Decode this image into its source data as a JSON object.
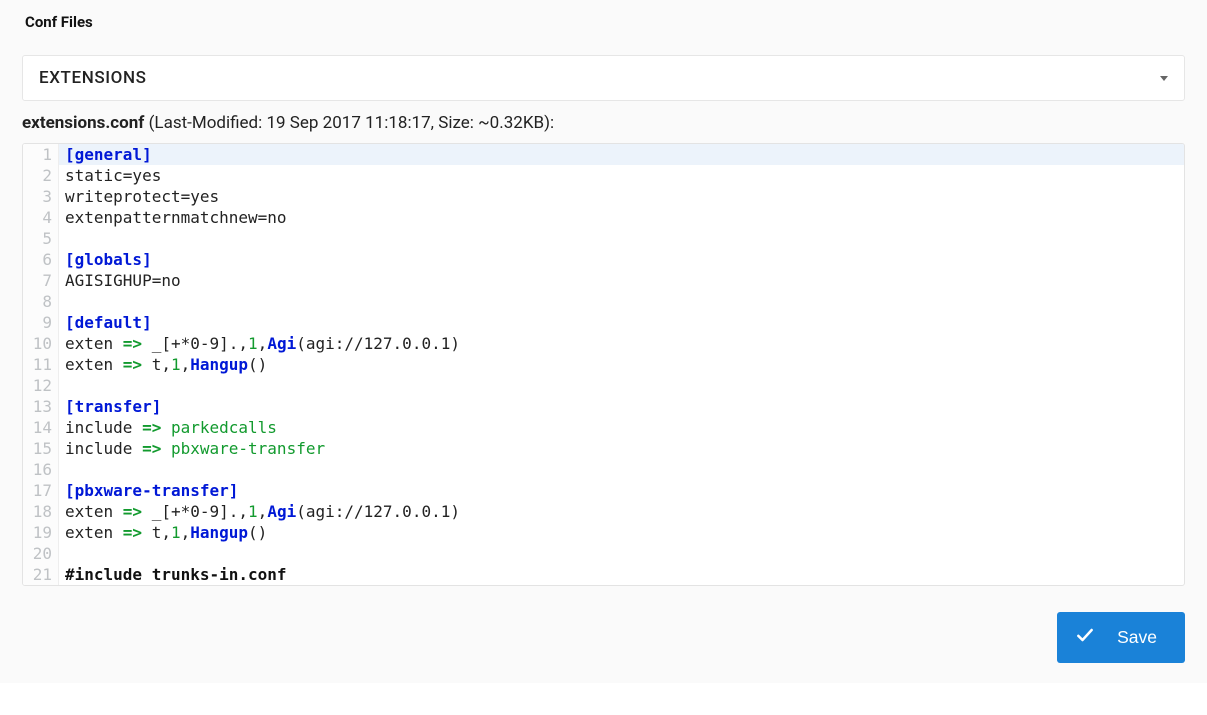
{
  "tab": {
    "label": "Conf Files"
  },
  "selector": {
    "value": "EXTENSIONS"
  },
  "fileinfo": {
    "name": "extensions.conf",
    "meta": " (Last-Modified: 19 Sep 2017 11:18:17, Size: ~0.32KB):"
  },
  "code": {
    "lines": [
      {
        "n": "1",
        "active": true,
        "tokens": [
          {
            "cls": "tok-section",
            "t": "[general]"
          }
        ]
      },
      {
        "n": "2",
        "tokens": [
          {
            "cls": "tok-key",
            "t": "static=yes"
          }
        ]
      },
      {
        "n": "3",
        "tokens": [
          {
            "cls": "tok-key",
            "t": "writeprotect=yes"
          }
        ]
      },
      {
        "n": "4",
        "tokens": [
          {
            "cls": "tok-key",
            "t": "extenpatternmatchnew=no"
          }
        ]
      },
      {
        "n": "5",
        "tokens": [
          {
            "cls": "tok-key",
            "t": ""
          }
        ]
      },
      {
        "n": "6",
        "tokens": [
          {
            "cls": "tok-section",
            "t": "[globals]"
          }
        ]
      },
      {
        "n": "7",
        "tokens": [
          {
            "cls": "tok-key",
            "t": "AGISIGHUP=no"
          }
        ]
      },
      {
        "n": "8",
        "tokens": [
          {
            "cls": "tok-key",
            "t": ""
          }
        ]
      },
      {
        "n": "9",
        "tokens": [
          {
            "cls": "tok-section",
            "t": "[default]"
          }
        ]
      },
      {
        "n": "10",
        "tokens": [
          {
            "cls": "tok-key",
            "t": "exten "
          },
          {
            "cls": "tok-op",
            "t": "=>"
          },
          {
            "cls": "tok-key",
            "t": " _[+*0-9].,"
          },
          {
            "cls": "tok-num",
            "t": "1"
          },
          {
            "cls": "tok-key",
            "t": ","
          },
          {
            "cls": "tok-fn",
            "t": "Agi"
          },
          {
            "cls": "tok-key",
            "t": "(agi://127.0.0.1)"
          }
        ]
      },
      {
        "n": "11",
        "tokens": [
          {
            "cls": "tok-key",
            "t": "exten "
          },
          {
            "cls": "tok-op",
            "t": "=>"
          },
          {
            "cls": "tok-key",
            "t": " t,"
          },
          {
            "cls": "tok-num",
            "t": "1"
          },
          {
            "cls": "tok-key",
            "t": ","
          },
          {
            "cls": "tok-fn",
            "t": "Hangup"
          },
          {
            "cls": "tok-key",
            "t": "()"
          }
        ]
      },
      {
        "n": "12",
        "tokens": [
          {
            "cls": "tok-key",
            "t": ""
          }
        ]
      },
      {
        "n": "13",
        "tokens": [
          {
            "cls": "tok-section",
            "t": "[transfer]"
          }
        ]
      },
      {
        "n": "14",
        "tokens": [
          {
            "cls": "tok-key",
            "t": "include "
          },
          {
            "cls": "tok-op",
            "t": "=>"
          },
          {
            "cls": "tok-key",
            "t": " "
          },
          {
            "cls": "tok-ctx",
            "t": "parkedcalls"
          }
        ]
      },
      {
        "n": "15",
        "tokens": [
          {
            "cls": "tok-key",
            "t": "include "
          },
          {
            "cls": "tok-op",
            "t": "=>"
          },
          {
            "cls": "tok-key",
            "t": " "
          },
          {
            "cls": "tok-ctx",
            "t": "pbxware-transfer"
          }
        ]
      },
      {
        "n": "16",
        "tokens": [
          {
            "cls": "tok-key",
            "t": ""
          }
        ]
      },
      {
        "n": "17",
        "tokens": [
          {
            "cls": "tok-section",
            "t": "[pbxware-transfer]"
          }
        ]
      },
      {
        "n": "18",
        "tokens": [
          {
            "cls": "tok-key",
            "t": "exten "
          },
          {
            "cls": "tok-op",
            "t": "=>"
          },
          {
            "cls": "tok-key",
            "t": " _[+*0-9].,"
          },
          {
            "cls": "tok-num",
            "t": "1"
          },
          {
            "cls": "tok-key",
            "t": ","
          },
          {
            "cls": "tok-fn",
            "t": "Agi"
          },
          {
            "cls": "tok-key",
            "t": "(agi://127.0.0.1)"
          }
        ]
      },
      {
        "n": "19",
        "tokens": [
          {
            "cls": "tok-key",
            "t": "exten "
          },
          {
            "cls": "tok-op",
            "t": "=>"
          },
          {
            "cls": "tok-key",
            "t": " t,"
          },
          {
            "cls": "tok-num",
            "t": "1"
          },
          {
            "cls": "tok-key",
            "t": ","
          },
          {
            "cls": "tok-fn",
            "t": "Hangup"
          },
          {
            "cls": "tok-key",
            "t": "()"
          }
        ]
      },
      {
        "n": "20",
        "tokens": [
          {
            "cls": "tok-key",
            "t": ""
          }
        ]
      },
      {
        "n": "21",
        "tokens": [
          {
            "cls": "tok-pre",
            "t": "#include trunks-in.conf"
          }
        ]
      }
    ]
  },
  "buttons": {
    "save": "Save"
  }
}
